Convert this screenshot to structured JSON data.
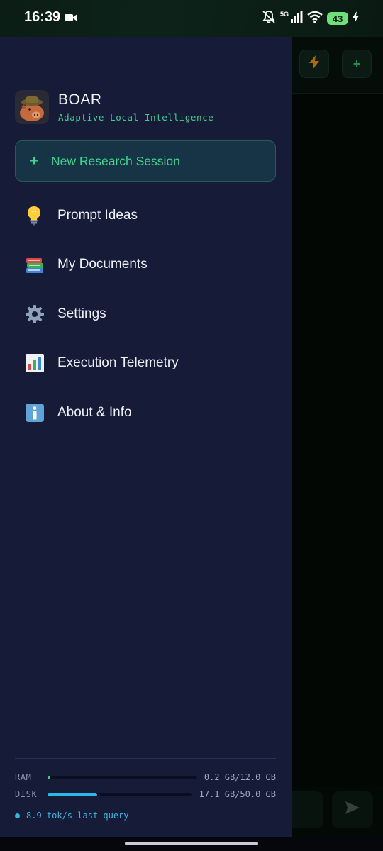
{
  "status_bar": {
    "time": "16:39",
    "network": "5G",
    "battery": "43",
    "icons": [
      "video-camera-icon",
      "muted-bell-icon",
      "signal-icon",
      "wifi-icon",
      "charging-icon"
    ]
  },
  "background_app": {
    "buttons": [
      "lightning-icon",
      "plus-icon"
    ],
    "accent": {
      "lightning": "#a86a10",
      "plus": "#1f8a5a"
    }
  },
  "drawer": {
    "app_name": "BOAR",
    "tagline": "Adaptive Local Intelligence",
    "new_session_label": "New Research Session",
    "menu": [
      {
        "label": "Prompt Ideas",
        "icon": "lightbulb-icon"
      },
      {
        "label": "My Documents",
        "icon": "books-icon"
      },
      {
        "label": "Settings",
        "icon": "gear-icon"
      },
      {
        "label": "Execution Telemetry",
        "icon": "bar-chart-icon"
      },
      {
        "label": "About & Info",
        "icon": "info-icon"
      }
    ],
    "stats": {
      "ram": {
        "label": "RAM",
        "value": "0.2 GB/12.0 GB",
        "fraction": 0.017
      },
      "disk": {
        "label": "DISK",
        "value": "17.1 GB/50.0 GB",
        "fraction": 0.342
      },
      "speed": "8.9 tok/s last query"
    }
  },
  "colors": {
    "drawer_bg": "#161b38",
    "accent_green": "#3ed68f",
    "accent_blue": "#2fb8e6"
  }
}
